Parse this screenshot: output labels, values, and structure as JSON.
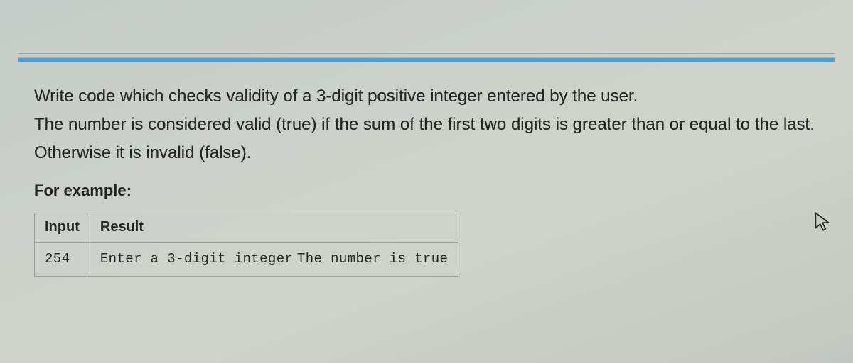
{
  "problem": {
    "line1": "Write code which checks validity of a 3-digit positive integer entered by the user.",
    "line2": "The number is considered valid (true) if the sum of the first two digits is greater than or equal to the last.",
    "line3": "Otherwise it is invalid (false).",
    "example_label": "For example:"
  },
  "table": {
    "headers": {
      "input": "Input",
      "result": "Result"
    },
    "row": {
      "input": "254",
      "result_line1": "Enter a 3-digit integer",
      "result_line2": "The number is true"
    }
  }
}
